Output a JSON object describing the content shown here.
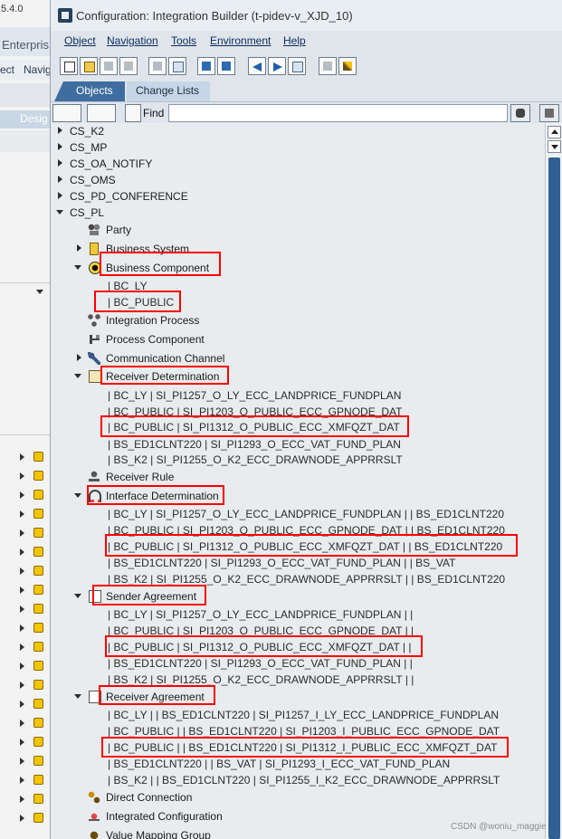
{
  "background_window": {
    "version_fragment": "5.4.0",
    "title_fragment": "Enterpris",
    "menu_fragments": [
      "ect",
      "Navig"
    ],
    "tab_fragment": "Desig"
  },
  "window": {
    "title": "Configuration: Integration Builder (t-pidev-v_XJD_10)"
  },
  "menu": {
    "items": [
      "Object",
      "Navigation",
      "Tools",
      "Environment",
      "Help"
    ]
  },
  "tabs": {
    "objects": "Objects",
    "change_lists": "Change Lists"
  },
  "find": {
    "label": "Find",
    "value": ""
  },
  "tree": {
    "top_nodes": [
      "CS_K2",
      "CS_MP",
      "CS_OA_NOTIFY",
      "CS_OMS",
      "CS_PD_CONFERENCE",
      "CS_PL"
    ],
    "categories": {
      "party": "Party",
      "business_system": "Business System",
      "business_component": "Business Component",
      "integration_process": "Integration Process",
      "process_component": "Process Component",
      "communication_channel": "Communication Channel",
      "receiver_determination": "Receiver Determination",
      "receiver_rule": "Receiver Rule",
      "interface_determination": "Interface Determination",
      "sender_agreement": "Sender Agreement",
      "receiver_agreement": "Receiver Agreement",
      "direct_connection": "Direct Connection",
      "integrated_configuration": "Integrated Configuration",
      "value_mapping_group": "Value Mapping Group"
    },
    "business_components": [
      "| BC_LY",
      "| BC_PUBLIC"
    ],
    "receiver_determinations": [
      "| BC_LY | SI_PI1257_O_LY_ECC_LANDPRICE_FUNDPLAN",
      "| BC_PUBLIC | SI_PI1203_O_PUBLIC_ECC_GPNODE_DAT",
      "| BC_PUBLIC | SI_PI1312_O_PUBLIC_ECC_XMFQZT_DAT",
      "| BS_ED1CLNT220 | SI_PI1293_O_ECC_VAT_FUND_PLAN",
      "| BS_K2 | SI_PI1255_O_K2_ECC_DRAWNODE_APPRRSLT"
    ],
    "interface_determinations": [
      "| BC_LY | SI_PI1257_O_LY_ECC_LANDPRICE_FUNDPLAN | | BS_ED1CLNT220",
      "| BC_PUBLIC | SI_PI1203_O_PUBLIC_ECC_GPNODE_DAT | | BS_ED1CLNT220",
      "| BC_PUBLIC | SI_PI1312_O_PUBLIC_ECC_XMFQZT_DAT | | BS_ED1CLNT220",
      "| BS_ED1CLNT220 | SI_PI1293_O_ECC_VAT_FUND_PLAN | | BS_VAT",
      "| BS_K2 | SI_PI1255_O_K2_ECC_DRAWNODE_APPRRSLT | | BS_ED1CLNT220"
    ],
    "sender_agreements": [
      "| BC_LY | SI_PI1257_O_LY_ECC_LANDPRICE_FUNDPLAN | |",
      "| BC_PUBLIC | SI_PI1203_O_PUBLIC_ECC_GPNODE_DAT | |",
      "| BC_PUBLIC | SI_PI1312_O_PUBLIC_ECC_XMFQZT_DAT | |",
      "| BS_ED1CLNT220 | SI_PI1293_O_ECC_VAT_FUND_PLAN | |",
      "| BS_K2 | SI_PI1255_O_K2_ECC_DRAWNODE_APPRRSLT | |"
    ],
    "receiver_agreements": [
      "| BC_LY | | BS_ED1CLNT220 | SI_PI1257_I_LY_ECC_LANDPRICE_FUNDPLAN",
      "| BC_PUBLIC | | BS_ED1CLNT220 | SI_PI1203_I_PUBLIC_ECC_GPNODE_DAT",
      "| BC_PUBLIC | | BS_ED1CLNT220 | SI_PI1312_I_PUBLIC_ECC_XMFQZT_DAT",
      "| BS_ED1CLNT220 | | BS_VAT | SI_PI1293_I_ECC_VAT_FUND_PLAN",
      "| BS_K2 | | BS_ED1CLNT220 | SI_PI1255_I_K2_ECC_DRAWNODE_APPRRSLT"
    ]
  },
  "highlight_color": "#ff0000",
  "accent_color": "#3e6e9f",
  "watermark": "CSDN @woniu_maggie"
}
